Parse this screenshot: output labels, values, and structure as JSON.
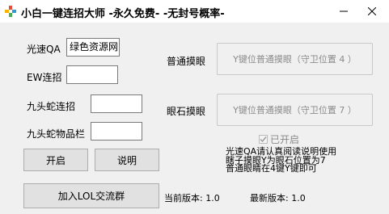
{
  "window": {
    "title": "小白一键连招大师 -永久免费- -无封号概率-"
  },
  "left_panel": {
    "guangsu_label": "光速QA",
    "guangsu_value": "绿色资源网",
    "ew_label": "EW连招",
    "ew_value": "",
    "hydra_combo_label": "九头蛇连招",
    "hydra_combo_value": "",
    "hydra_slot_label": "九头蛇物品栏",
    "hydra_slot_value": ""
  },
  "right_panel": {
    "normal_label": "普通摸眼",
    "normal_value": "Y键位普通摸眼（守卫位置 4 ）",
    "stone_label": "眼石摸眼",
    "stone_value": "Y键位普通摸眼（守卫位置 7 ）",
    "enabled_label": "已开启",
    "enabled_checked": true,
    "notes": [
      "光速QA请认真阅读说明使用",
      "瞎子摸眼Y为眼石位置为7",
      "普通眼睛在4键Y键即可"
    ]
  },
  "buttons": {
    "start": "开启",
    "help": "说明",
    "join_group": "加入LOL交流群"
  },
  "footer": {
    "current_version": "当前版本: 1.0",
    "latest_version": "最新版本: 1.0"
  }
}
